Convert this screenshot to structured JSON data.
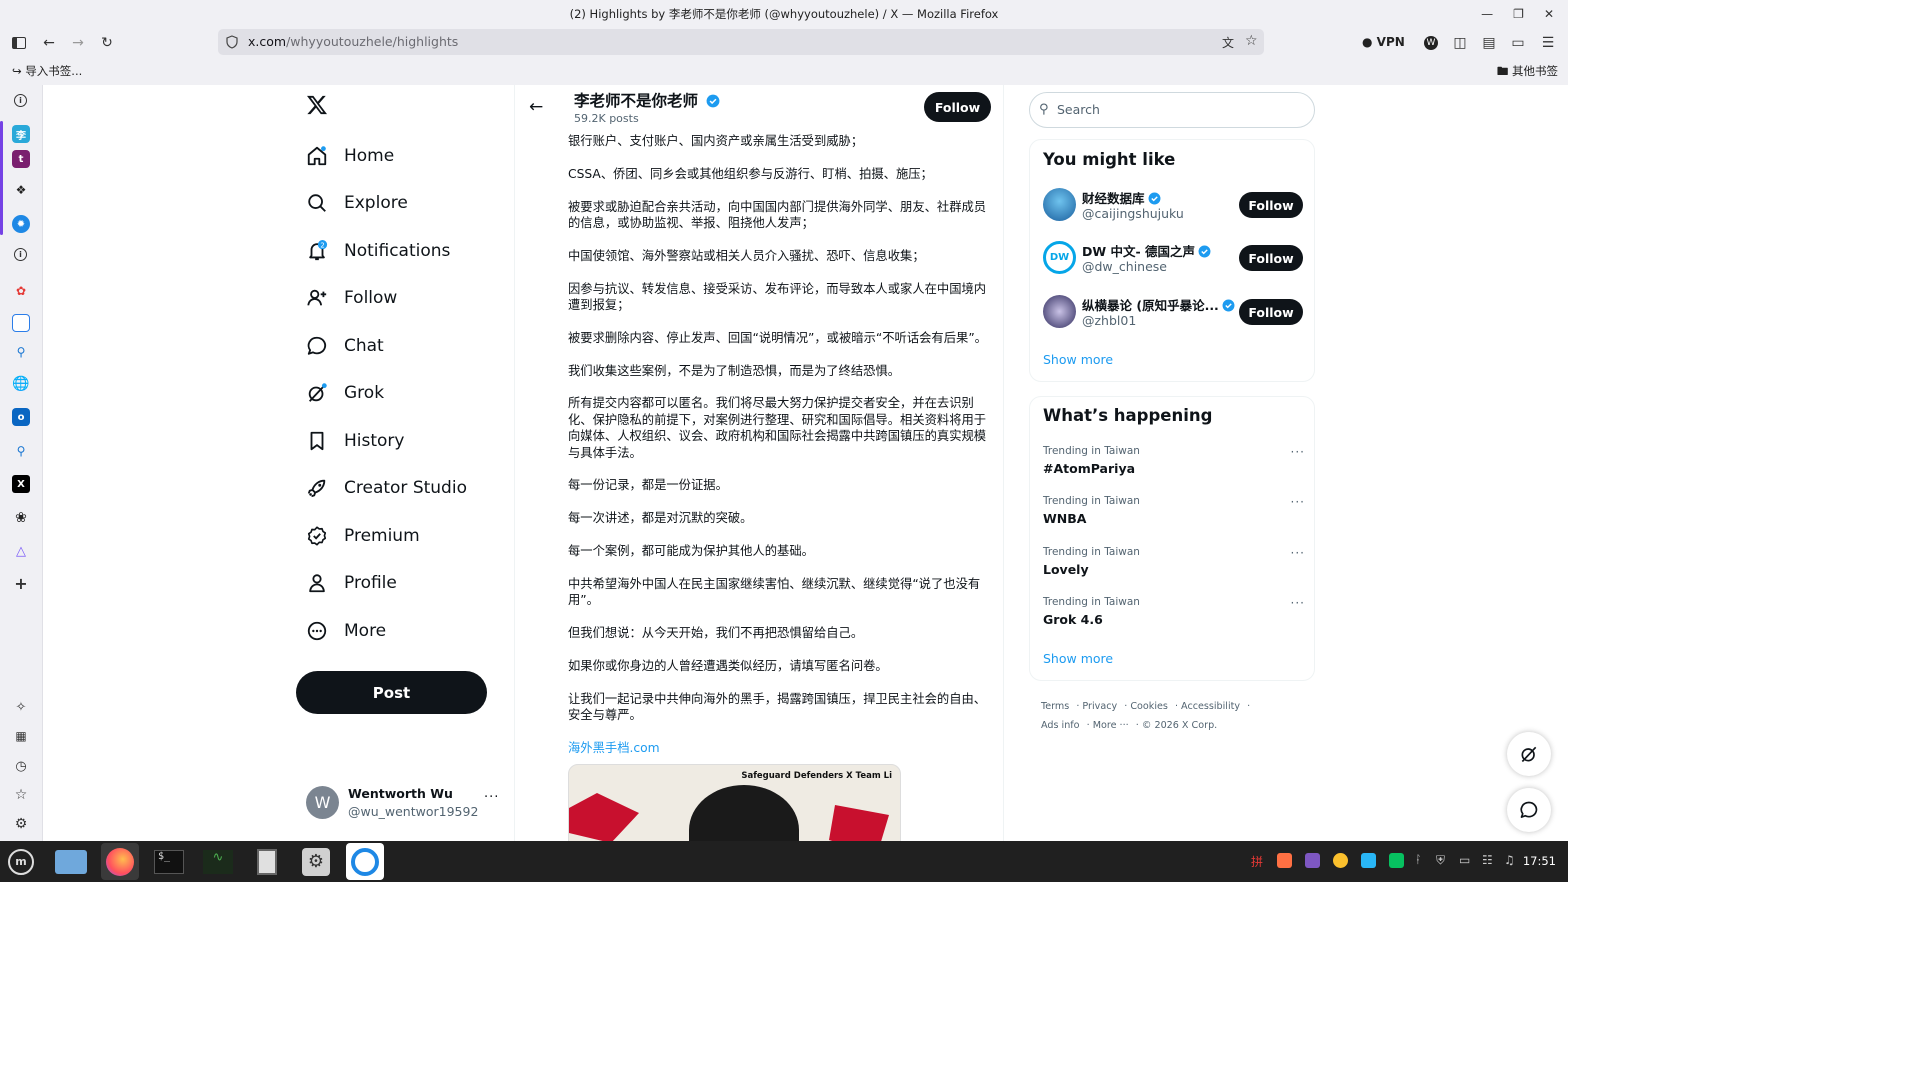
{
  "window": {
    "title": "(2) Highlights by 李老师不是你老师 (@whyyoutouzhele) / X — Mozilla Firefox"
  },
  "browser": {
    "url_host": "x.com",
    "url_path": "/whyyoutouzhele/highlights",
    "vpn_label": "VPN",
    "bookmarks_left": "导入书签...",
    "bookmarks_right": "其他书签"
  },
  "nav": {
    "items": [
      {
        "label": "Home",
        "icon": "home-icon"
      },
      {
        "label": "Explore",
        "icon": "search-icon"
      },
      {
        "label": "Notifications",
        "icon": "bell-icon",
        "badge": "2"
      },
      {
        "label": "Follow",
        "icon": "person-add-icon"
      },
      {
        "label": "Chat",
        "icon": "chat-bubble-icon"
      },
      {
        "label": "Grok",
        "icon": "grok-icon"
      },
      {
        "label": "History",
        "icon": "bookmark-icon"
      },
      {
        "label": "Creator Studio",
        "icon": "rocket-icon"
      },
      {
        "label": "Premium",
        "icon": "verified-badge-icon"
      },
      {
        "label": "Profile",
        "icon": "person-icon"
      },
      {
        "label": "More",
        "icon": "more-circle-icon"
      }
    ],
    "post_label": "Post",
    "account": {
      "avatar_letter": "W",
      "name": "Wentworth Wu",
      "handle": "@wu_wentwor19592"
    }
  },
  "profile_header": {
    "name": "李老师不是你老师",
    "posts": "59.2K posts",
    "follow_label": "Follow"
  },
  "feed": {
    "paragraphs": [
      "银行账户、支付账户、国内资产或亲属生活受到威胁；",
      "CSSA、侨团、同乡会或其他组织参与反游行、盯梢、拍摄、施压；",
      "被要求或胁迫配合亲共活动，向中国国内部门提供海外同学、朋友、社群成员的信息，或协助监视、举报、阻挠他人发声；",
      "中国使领馆、海外警察站或相关人员介入骚扰、恐吓、信息收集；",
      "因参与抗议、转发信息、接受采访、发布评论，而导致本人或家人在中国境内遭到报复；",
      "被要求删除内容、停止发声、回国“说明情况”，或被暗示“不听话会有后果”。",
      "我们收集这些案例，不是为了制造恐惧，而是为了终结恐惧。",
      "所有提交内容都可以匿名。我们将尽最大努力保护提交者安全，并在去识别化、保护隐私的前提下，对案例进行整理、研究和国际倡导。相关资料将用于向媒体、人权组织、议会、政府机构和国际社会揭露中共跨国镇压的真实规模与具体手法。",
      "每一份记录，都是一份证据。",
      "每一次讲述，都是对沉默的突破。",
      "每一个案例，都可能成为保护其他人的基础。",
      "中共希望海外中国人在民主国家继续害怕、继续沉默、继续觉得“说了也没有用”。",
      "但我们想说：从今天开始，我们不再把恐惧留给自己。",
      "如果你或你身边的人曾经遭遇类似经历，请填写匿名问卷。",
      "让我们一起记录中共伸向海外的黑手，揭露跨国镇压，捍卫民主社会的自由、安全与尊严。"
    ],
    "link": "海外黑手档.com",
    "image_caption": "Safeguard Defenders X Team Li"
  },
  "sidebar": {
    "search_placeholder": "Search",
    "you_might_like": {
      "title": "You might like",
      "items": [
        {
          "name": "财经数据库",
          "handle": "@caijingshujuku",
          "follow": "Follow"
        },
        {
          "name": "DW 中文- 德国之声",
          "handle": "@dw_chinese",
          "follow": "Follow"
        },
        {
          "name": "纵横暴论 (原知乎暴论...",
          "handle": "@zhbl01",
          "follow": "Follow"
        }
      ],
      "show_more": "Show more"
    },
    "whats_happening": {
      "title": "What’s happening",
      "items": [
        {
          "meta": "Trending in Taiwan",
          "name": "#AtomPariya"
        },
        {
          "meta": "Trending in Taiwan",
          "name": "WNBA"
        },
        {
          "meta": "Trending in Taiwan",
          "name": "Lovely"
        },
        {
          "meta": "Trending in Taiwan",
          "name": "Grok 4.6"
        }
      ],
      "show_more": "Show more"
    },
    "footer": [
      "Terms",
      "Privacy",
      "Cookies",
      "Accessibility",
      "Ads info",
      "More ···",
      "© 2026 X Corp."
    ]
  },
  "taskbar": {
    "clock": "17:51"
  },
  "colors": {
    "accent": "#1d9bf0",
    "dark": "#0f1419",
    "muted": "#536471",
    "firefox_active": "#7542e5"
  }
}
